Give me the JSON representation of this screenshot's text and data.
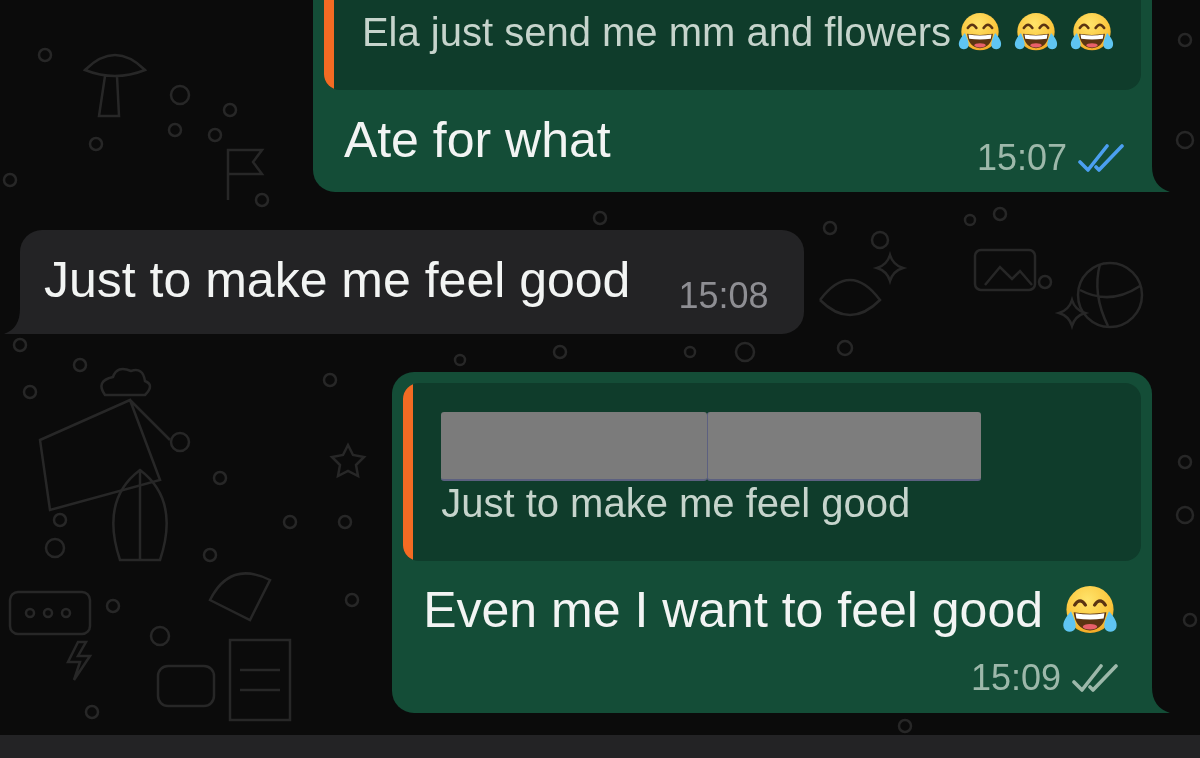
{
  "messages": [
    {
      "kind": "outgoing",
      "quote": {
        "text": "Ela just send me mm and flowers",
        "emojis": [
          {
            "kind": "tears-of-joy"
          },
          {
            "kind": "tears-of-joy"
          },
          {
            "kind": "tears-of-joy"
          }
        ]
      },
      "text": "Ate for what",
      "time": "15:07",
      "read": true
    },
    {
      "kind": "incoming",
      "text": "Just to make me feel good",
      "time": "15:08"
    },
    {
      "kind": "outgoing",
      "quote": {
        "sender_redacted": true,
        "text": "Just to make me feel good"
      },
      "text": "Even me I want to feel good",
      "emojis": [
        {
          "kind": "tears-of-joy"
        }
      ],
      "time": "15:09",
      "read": false
    }
  ]
}
